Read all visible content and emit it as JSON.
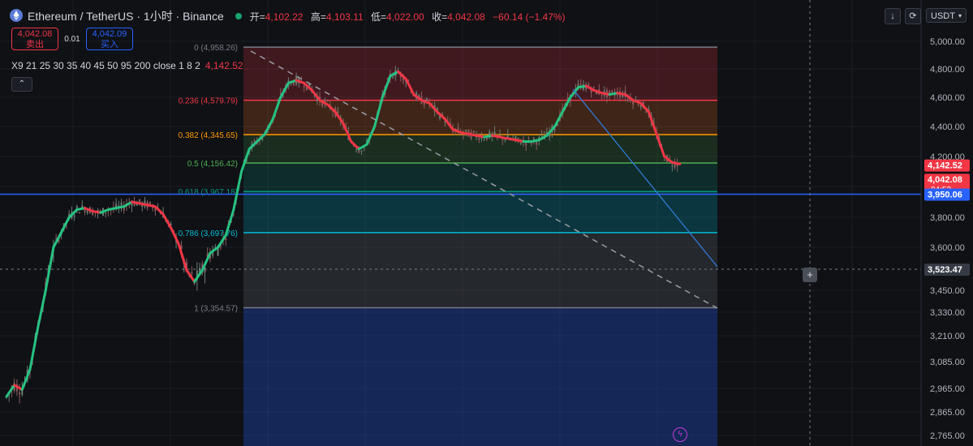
{
  "header": {
    "symbol": "Ethereum / TetherUS · 1小时 · Binance",
    "ohlc": [
      {
        "label": "开=",
        "value": "4,102.22"
      },
      {
        "label": "高=",
        "value": "4,103.11"
      },
      {
        "label": "低=",
        "value": "4,022.00"
      },
      {
        "label": "收=",
        "value": "4,042.08"
      }
    ],
    "change": "−60.14 (−1.47%)"
  },
  "trade": {
    "sell_price": "4,042.08",
    "sell_label": "卖出",
    "spread": "0.01",
    "buy_price": "4,042.09",
    "buy_label": "买入"
  },
  "indicator": {
    "label": "X9 21 25 30 35 40 45 50 95 200 close 1 8 2",
    "value": "4,142.52",
    "collapse_glyph": "⌃"
  },
  "toolbar": {
    "down_glyph": "↓",
    "reset_glyph": "⟳",
    "currency": "USDT",
    "currency_arrow": "▾"
  },
  "colors": {
    "background": "#0f1115",
    "bull": "#26c281",
    "bear": "#f23645",
    "fib_0": "#787b86",
    "fib_0236": "#f23645",
    "fib_0382": "#ff9800",
    "fib_05": "#4caf50",
    "fib_0618": "#089981",
    "fib_0786": "#00bcd4",
    "fib_1": "#787b86",
    "blue_line": "#2962ff"
  },
  "chart_data": {
    "type": "line",
    "title": "Ethereum / TetherUS · 1小时 · Binance",
    "ylim": [
      2720,
      5070
    ],
    "y_ticks": [
      "5,000.00",
      "4,800.00",
      "4,600.00",
      "4,400.00",
      "4,200.00",
      "4,000.00",
      "3,800.00",
      "3,600.00",
      "3,450.00",
      "3,330.00",
      "3,210.00",
      "3,085.00",
      "2,965.00",
      "2,865.00",
      "2,765.00"
    ],
    "y_tick_values": [
      5000,
      4800,
      4600,
      4400,
      4200,
      4000,
      3800,
      3600,
      3450,
      3330,
      3210,
      3085,
      2965,
      2865,
      2765
    ],
    "fib_levels": [
      {
        "ratio": "0",
        "label": "0 (4,958.26)",
        "price": 4958.26
      },
      {
        "ratio": "0.236",
        "label": "0.236 (4,579.79)",
        "price": 4579.79
      },
      {
        "ratio": "0.382",
        "label": "0.382 (4,345.65)",
        "price": 4345.65
      },
      {
        "ratio": "0.5",
        "label": "0.5 (4,156.42)",
        "price": 4156.42
      },
      {
        "ratio": "0.618",
        "label": "0.618 (3,967.18)",
        "price": 3967.18
      },
      {
        "ratio": "0.786",
        "label": "0.786 (3,697.76)",
        "price": 3697.76
      },
      {
        "ratio": "1",
        "label": "1 (3,354.57)",
        "price": 3354.57
      }
    ],
    "price_labels": [
      {
        "text": "4,142.52",
        "price": 4142.52,
        "color": "#f23645"
      },
      {
        "text": "4,042.08",
        "sub": "04:53",
        "price": 4042.08,
        "color": "#f23645"
      },
      {
        "text": "3,950.06",
        "price": 3950.06,
        "color": "#2962ff"
      },
      {
        "text": "3,523.47",
        "price": 3523.47,
        "color": "#363a45"
      }
    ],
    "horizontal_line_price": 3950.06,
    "crosshair_price": 3523.47,
    "series": [
      {
        "values": [
          2930,
          2980,
          2960,
          3050,
          3250,
          3450,
          3600,
          3700,
          3800,
          3850,
          3860,
          3840,
          3830,
          3850,
          3860,
          3870,
          3900,
          3890,
          3880,
          3870,
          3820,
          3730,
          3620,
          3520,
          3480,
          3520,
          3580,
          3600,
          3680,
          3850,
          4100,
          4250,
          4300,
          4350,
          4450,
          4600,
          4700,
          4720,
          4700,
          4650,
          4580,
          4550,
          4500,
          4420,
          4300,
          4250,
          4280,
          4400,
          4600,
          4750,
          4780,
          4730,
          4620,
          4580,
          4560,
          4500,
          4450,
          4380,
          4360,
          4350,
          4340,
          4330,
          4340,
          4330,
          4320,
          4310,
          4300,
          4300,
          4310,
          4340,
          4400,
          4500,
          4600,
          4670,
          4680,
          4650,
          4630,
          4620,
          4630,
          4620,
          4580,
          4560,
          4500,
          4350,
          4200,
          4160,
          4150
        ]
      }
    ]
  }
}
